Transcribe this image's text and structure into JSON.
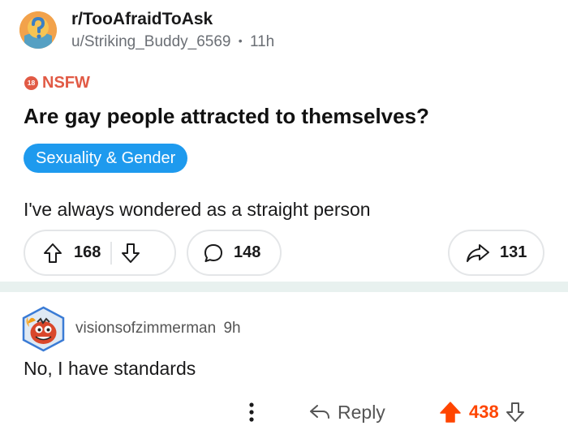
{
  "post": {
    "subreddit": "r/TooAfraidToAsk",
    "author": "u/Striking_Buddy_6569",
    "separator": "•",
    "age": "11h",
    "nsfw_badge_number": "18",
    "nsfw_label": "NSFW",
    "title": "Are gay people attracted to themselves?",
    "flair": "Sexuality & Gender",
    "body": "I've always wondered as a straight person",
    "upvotes": "168",
    "comments": "148",
    "shares": "131"
  },
  "comment": {
    "username": "visionsofzimmerman",
    "age": "9h",
    "text": "No, I have standards",
    "reply_label": "Reply",
    "score": "438"
  },
  "icons": {
    "subreddit_avatar": "question-mark-avatar-icon",
    "upvote": "arrow-up-outline-icon",
    "downvote": "arrow-down-outline-icon",
    "comment": "speech-bubble-icon",
    "share": "share-arrow-icon",
    "more": "kebab-menu-icon",
    "reply": "reply-arrow-icon",
    "comment_upvote": "arrow-up-filled-icon",
    "user_avatar": "monster-hexagon-avatar-icon"
  },
  "colors": {
    "nsfw": "#e15a45",
    "flair_bg": "#1e9aee",
    "upvoted": "#ff4500",
    "divider_band": "#e8f1ef",
    "muted_text": "#6b6f75"
  }
}
